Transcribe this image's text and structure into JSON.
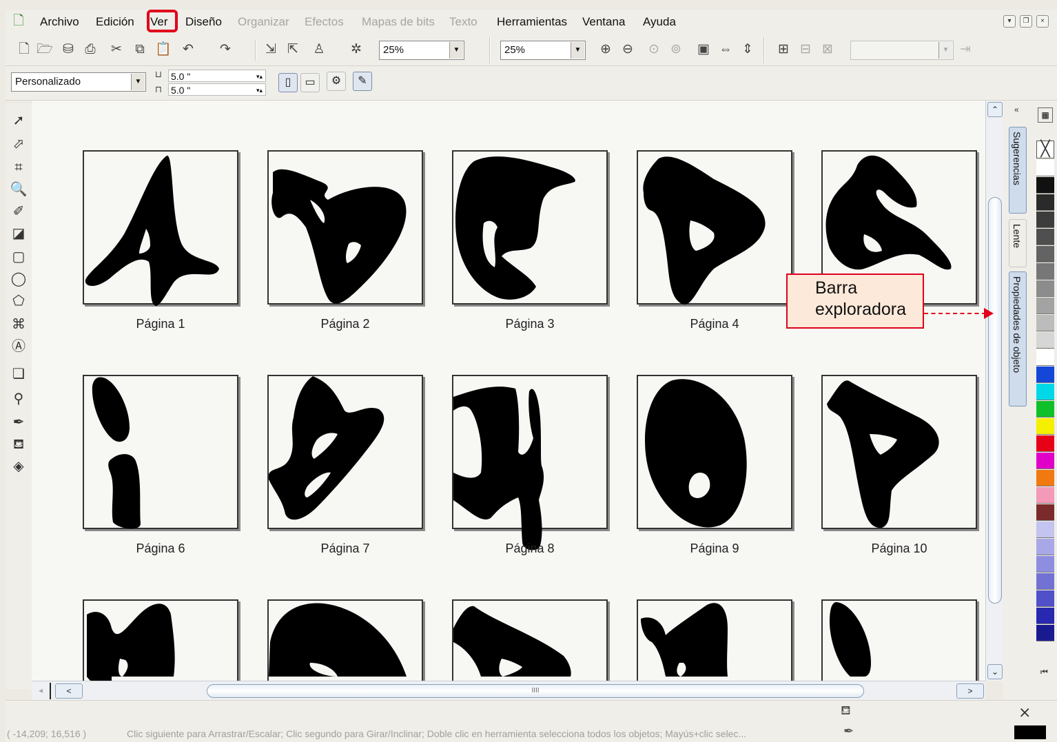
{
  "menu": {
    "app_icon": "document-icon",
    "items": [
      {
        "label": "Archivo",
        "disabled": false
      },
      {
        "label": "Edición",
        "disabled": false
      },
      {
        "label": "Ver",
        "disabled": false,
        "highlighted": true
      },
      {
        "label": "Diseño",
        "disabled": false
      },
      {
        "label": "Organizar",
        "disabled": true
      },
      {
        "label": "Efectos",
        "disabled": true
      },
      {
        "label": "Mapas de bits",
        "disabled": true
      },
      {
        "label": "Texto",
        "disabled": true
      },
      {
        "label": "Herramientas",
        "disabled": false
      },
      {
        "label": "Ventana",
        "disabled": false
      },
      {
        "label": "Ayuda",
        "disabled": false
      }
    ],
    "window_buttons": [
      "minimize-icon",
      "restore-icon",
      "close-icon"
    ]
  },
  "standard_toolbar": {
    "zoom_level_1": "25%",
    "zoom_level_2": "25%"
  },
  "property_bar": {
    "page_size": "Personalizado",
    "nudge_1": "5.0 \"",
    "nudge_2": "5.0 \""
  },
  "pages": [
    {
      "label": "Página  1",
      "letter": "A"
    },
    {
      "label": "Página  2",
      "letter": "B"
    },
    {
      "label": "Página  3",
      "letter": "C"
    },
    {
      "label": "Página  4",
      "letter": "D"
    },
    {
      "label": "Página  5",
      "letter": "E"
    },
    {
      "label": "Página  6",
      "letter": "i"
    },
    {
      "label": "Página  7",
      "letter": "G"
    },
    {
      "label": "Página  8",
      "letter": "H"
    },
    {
      "label": "Página  9",
      "letter": "O"
    },
    {
      "label": "Página  10",
      "letter": "P"
    },
    {
      "label": "",
      "letter": "K"
    },
    {
      "label": "",
      "letter": "O"
    },
    {
      "label": "",
      "letter": "R"
    },
    {
      "label": "",
      "letter": "N"
    },
    {
      "label": "",
      "letter": "I"
    }
  ],
  "dockers": [
    {
      "label": "Sugerencias"
    },
    {
      "label": "Lente"
    },
    {
      "label": "Propiedades de objeto"
    }
  ],
  "callout": {
    "line1": "Barra",
    "line2": "exploradora"
  },
  "palette": [
    "#ffffff",
    "#111111",
    "#2a2a2a",
    "#3c3c3c",
    "#4f4f4f",
    "#636363",
    "#777777",
    "#8c8c8c",
    "#a3a3a3",
    "#bcbcbc",
    "#d6d6d6",
    "#ffffff",
    "#1446d8",
    "#00d8e8",
    "#10c02a",
    "#f4f000",
    "#e60018",
    "#e000c8",
    "#f07a10",
    "#f49ab8",
    "#7a2a2a",
    "#c4c4f0",
    "#a8a8e8",
    "#8e8ee0",
    "#7272d4",
    "#5050c8",
    "#2828b0",
    "#1a1a90"
  ],
  "status": {
    "coords": "( -14,209; 16,516 )",
    "message": "Clic siguiente para Arrastrar/Escalar; Clic segundo para Girar/Inclinar; Doble clic en herramienta selecciona todos los objetos; Mayús+clic selec..."
  }
}
